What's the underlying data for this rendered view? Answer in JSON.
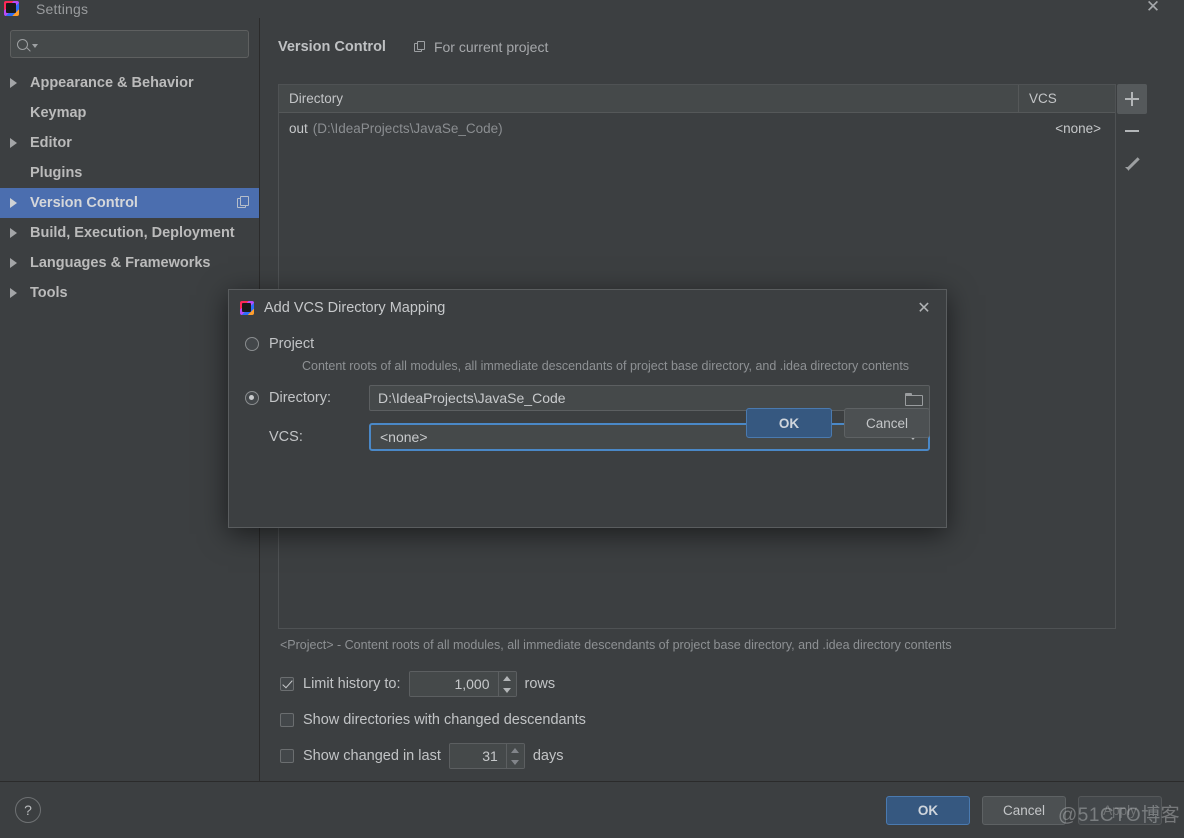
{
  "window": {
    "title": "Settings",
    "app_icon": "intellij-idea-logo",
    "close_icon": "✕"
  },
  "sidebar": {
    "search": {
      "placeholder": "",
      "value": "",
      "icon": "search-icon"
    },
    "items": [
      {
        "label": "Appearance & Behavior",
        "expandable": true,
        "selected": false
      },
      {
        "label": "Keymap",
        "expandable": false,
        "selected": false
      },
      {
        "label": "Editor",
        "expandable": true,
        "selected": false
      },
      {
        "label": "Plugins",
        "expandable": false,
        "selected": false
      },
      {
        "label": "Version Control",
        "expandable": true,
        "selected": true,
        "badge": "copy-icon"
      },
      {
        "label": "Build, Execution, Deployment",
        "expandable": true,
        "selected": false
      },
      {
        "label": "Languages & Frameworks",
        "expandable": true,
        "selected": false
      },
      {
        "label": "Tools",
        "expandable": true,
        "selected": false
      }
    ]
  },
  "content": {
    "title": "Version Control",
    "scope_label": "For current project",
    "scope_icon": "copy-icon",
    "table": {
      "columns": [
        "Directory",
        "VCS"
      ],
      "rows": [
        {
          "dir_name": "out",
          "dir_path": "(D:\\IdeaProjects\\JavaSe_Code)",
          "vcs": "<none>"
        }
      ],
      "tools": [
        {
          "name": "add",
          "icon": "plus-icon",
          "active": true
        },
        {
          "name": "remove",
          "icon": "minus-icon",
          "active": false
        },
        {
          "name": "edit",
          "icon": "pencil-icon",
          "active": false
        }
      ]
    },
    "note": "<Project> - Content roots of all modules, all immediate descendants of project base directory, and .idea directory contents",
    "options": {
      "limit_history": {
        "checked": true,
        "label": "Limit history to:",
        "value": "1,000",
        "suffix": "rows"
      },
      "show_directories": {
        "checked": false,
        "label": "Show directories with changed descendants"
      },
      "show_changed_in_last": {
        "checked": false,
        "label": "Show changed in last",
        "value": "31",
        "suffix": "days"
      }
    }
  },
  "dialog": {
    "title": "Add VCS Directory Mapping",
    "icon": "intellij-idea-logo",
    "close_icon": "✕",
    "radio_project": {
      "label": "Project",
      "selected": false
    },
    "project_hint": "Content roots of all modules, all immediate descendants of project base directory, and .idea directory contents",
    "radio_directory": {
      "label": "Directory:",
      "selected": true
    },
    "directory_value": "D:\\IdeaProjects\\JavaSe_Code",
    "browse_icon": "folder-icon",
    "vcs_label": "VCS:",
    "vcs_value": "<none>",
    "ok_label": "OK",
    "cancel_label": "Cancel"
  },
  "footer": {
    "help_label": "?",
    "ok_label": "OK",
    "cancel_label": "Cancel",
    "apply_label": "Apply",
    "apply_disabled": true,
    "watermark": "@51CTO博客"
  },
  "colors": {
    "background": "#3c3f41",
    "selection": "#4b6eaf",
    "primary_button": "#365880",
    "focus_ring": "#4a88c7",
    "text": "#bbbbbb",
    "muted_text": "#8e9194"
  }
}
